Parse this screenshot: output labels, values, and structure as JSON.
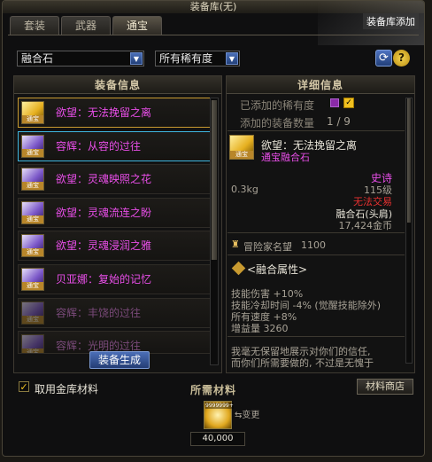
{
  "window": {
    "title": "装备库(无)",
    "overlay_text": "装备库添加"
  },
  "tabs": [
    {
      "label": "套装"
    },
    {
      "label": "武器"
    },
    {
      "label": "通宝"
    }
  ],
  "filters": {
    "category": "融合石",
    "rarity": "所有稀有度"
  },
  "left_panel": {
    "header": "装备信息",
    "items": [
      {
        "name": "欲望：无法挽留之离",
        "icon": "gold-tongbao-icon"
      },
      {
        "name": "容辉：从容的过往",
        "icon": "purple-tongbao-icon"
      },
      {
        "name": "欲望：灵魂映照之花",
        "icon": "purple-tongbao-icon"
      },
      {
        "name": "欲望：灵魂流连之盼",
        "icon": "purple-tongbao-icon"
      },
      {
        "name": "欲望：灵魂浸润之雅",
        "icon": "purple-tongbao-icon"
      },
      {
        "name": "贝亚娜：复始的记忆",
        "icon": "purple-tongbao-icon"
      },
      {
        "name": "容辉：丰饶的过往",
        "icon": "purple-tongbao-icon"
      },
      {
        "name": "容辉：光明的过往",
        "icon": "purple-tongbao-icon"
      }
    ],
    "icon_tag": "通宝",
    "generate_button": "装备生成"
  },
  "right_panel": {
    "header": "详细信息",
    "added_rarity_label": "已添加的稀有度",
    "added_count_label": "添加的装备数量",
    "added_count_value": "1 / 9",
    "item_name": "欲望：无法挽留之离",
    "item_type": "通宝融合石",
    "icon_tag": "通宝",
    "rarity": "史诗",
    "level": "115级",
    "weight": "0.3kg",
    "trade": "无法交易",
    "slot": "融合石(头肩)",
    "price": "17,424金币",
    "fame_label": "冒险家名望",
    "fame_value": "1100",
    "fusion_title": "<融合属性>",
    "stats": [
      "技能伤害 +10%",
      "技能冷却时间 -4% (觉醒技能除外)",
      "所有速度 +8%",
      "增益量 3260"
    ],
    "flavor_1": "我毫无保留地展示对你们的信任,",
    "flavor_2": "而你们所需要做的, 不过是无愧于"
  },
  "bottom": {
    "use_gold_label": "取用金库材料",
    "material_title": "所需材料",
    "shop_button": "材料商店",
    "gold_icon_amount": "9999999+",
    "change_label": "变更",
    "gold_value": "40,000"
  },
  "colors": {
    "epic_pink": "#e84ee8",
    "gold_text": "#e8c060",
    "untradable_red": "#e83030",
    "select_blue": "#3fb6e0",
    "select_yellow": "#c89a30"
  }
}
